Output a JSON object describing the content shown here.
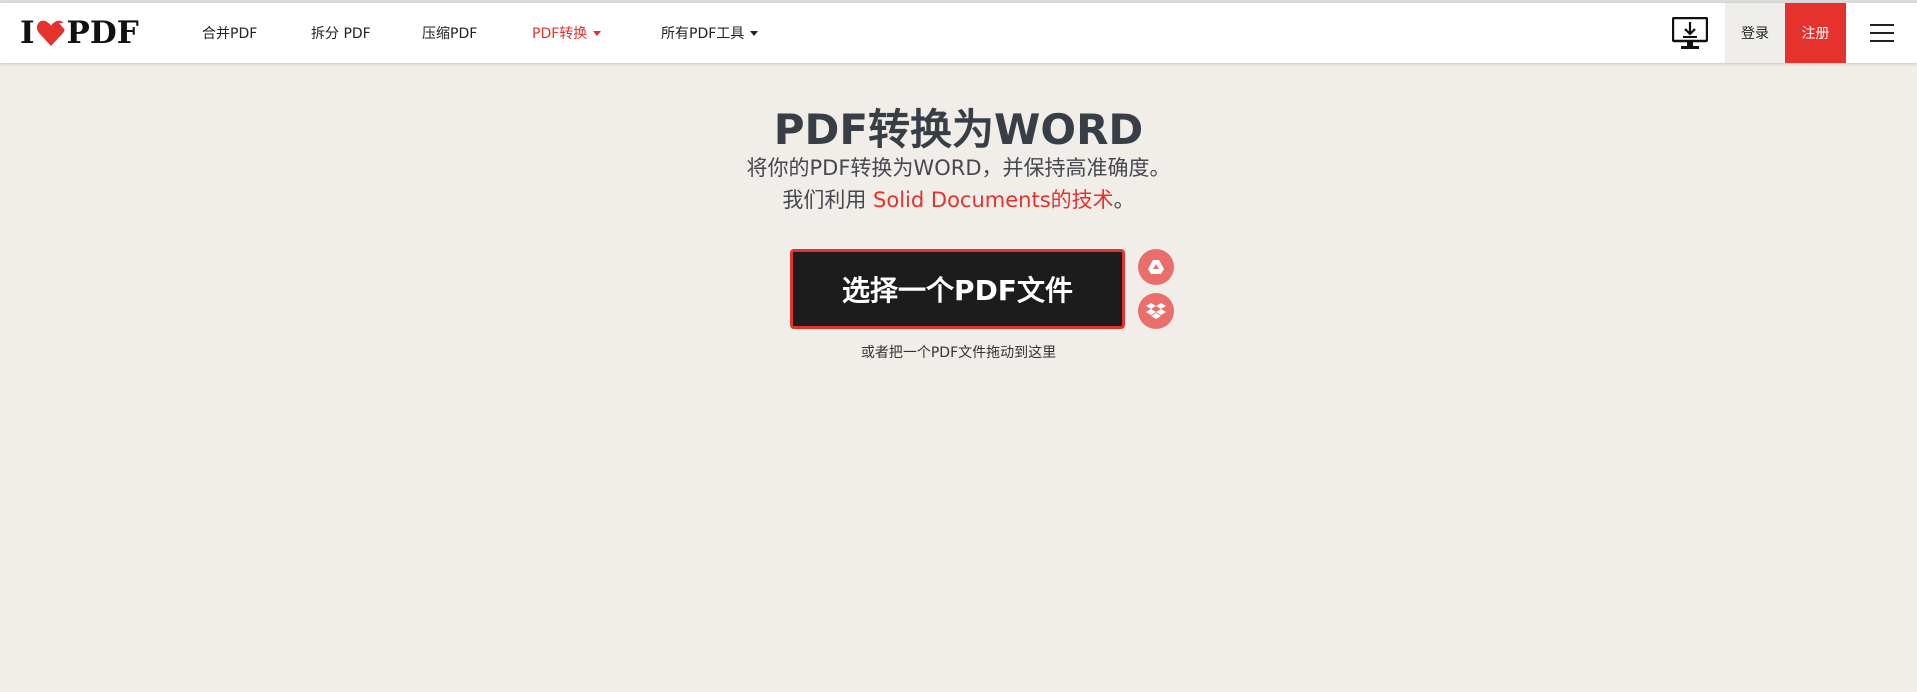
{
  "brand": {
    "logo_left": "I",
    "logo_right": "PDF",
    "accent": "#e5322d"
  },
  "nav": {
    "items": [
      {
        "label": "合并PDF"
      },
      {
        "label": "拆分 PDF"
      },
      {
        "label": "压缩PDF"
      },
      {
        "label": "PDF转换",
        "active": true,
        "dropdown": true
      },
      {
        "label": "所有PDF工具",
        "dropdown": true
      }
    ]
  },
  "header_right": {
    "desktop_icon": "desktop-download-icon",
    "login_label": "登录",
    "signup_label": "注册",
    "menu_icon": "hamburger-menu-icon"
  },
  "main": {
    "title": "PDF转换为WORD",
    "subtitle_line1": "将你的PDF转换为WORD，并保持高准确度。",
    "subtitle_line2_prefix": "我们利用 ",
    "subtitle_line2_link": "Solid Documents的技术",
    "subtitle_line2_suffix": "。",
    "select_button": "选择一个PDF文件",
    "drop_hint": "或者把一个PDF文件拖动到这里",
    "cloud_icons": [
      "google-drive-icon",
      "dropbox-icon"
    ]
  }
}
